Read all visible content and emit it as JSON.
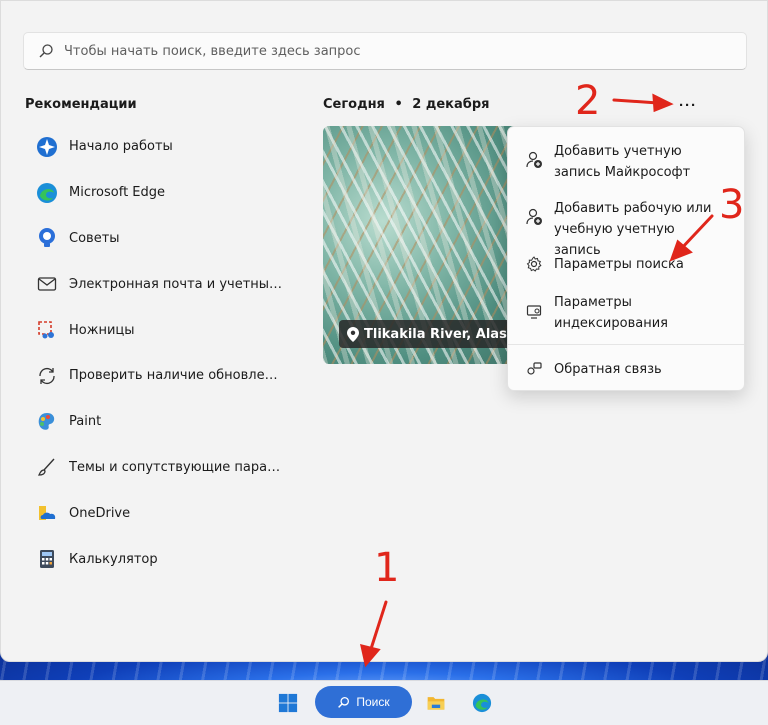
{
  "search": {
    "placeholder": "Чтобы начать поиск, введите здесь запрос"
  },
  "recommendations": {
    "title": "Рекомендации",
    "items": [
      {
        "label": "Начало работы",
        "icon": "get-started-icon"
      },
      {
        "label": "Microsoft Edge",
        "icon": "edge-icon"
      },
      {
        "label": "Советы",
        "icon": "tips-icon"
      },
      {
        "label": "Электронная почта и учетные ...",
        "icon": "mail-icon"
      },
      {
        "label": "Ножницы",
        "icon": "snipping-tool-icon"
      },
      {
        "label": "Проверить наличие обновлен...",
        "icon": "update-icon"
      },
      {
        "label": "Paint",
        "icon": "paint-icon"
      },
      {
        "label": "Темы и сопутствующие парам...",
        "icon": "brush-icon"
      },
      {
        "label": "OneDrive",
        "icon": "onedrive-icon"
      },
      {
        "label": "Калькулятор",
        "icon": "calculator-icon"
      }
    ]
  },
  "today": {
    "label": "Сегодня",
    "separator": "•",
    "date": "2 декабря",
    "more": "···"
  },
  "photo": {
    "caption": "Tlikakila River, Alaska"
  },
  "menu": {
    "items": [
      {
        "label": "Добавить учетную запись Майкрософт",
        "icon": "add-account-icon"
      },
      {
        "label": "Добавить рабочую или учебную учетную запись",
        "icon": "add-work-account-icon"
      },
      {
        "label": "Параметры поиска",
        "icon": "settings-gear-icon"
      },
      {
        "label": "Параметры индексирования",
        "icon": "indexing-icon"
      },
      {
        "label": "Обратная связь",
        "icon": "feedback-icon"
      }
    ]
  },
  "annotations": {
    "one": "1",
    "two": "2",
    "three": "3",
    "color": "#e0261b"
  },
  "taskbar": {
    "search_label": "Поиск",
    "icons": [
      "windows-start-icon",
      "file-explorer-icon",
      "edge-icon"
    ]
  }
}
